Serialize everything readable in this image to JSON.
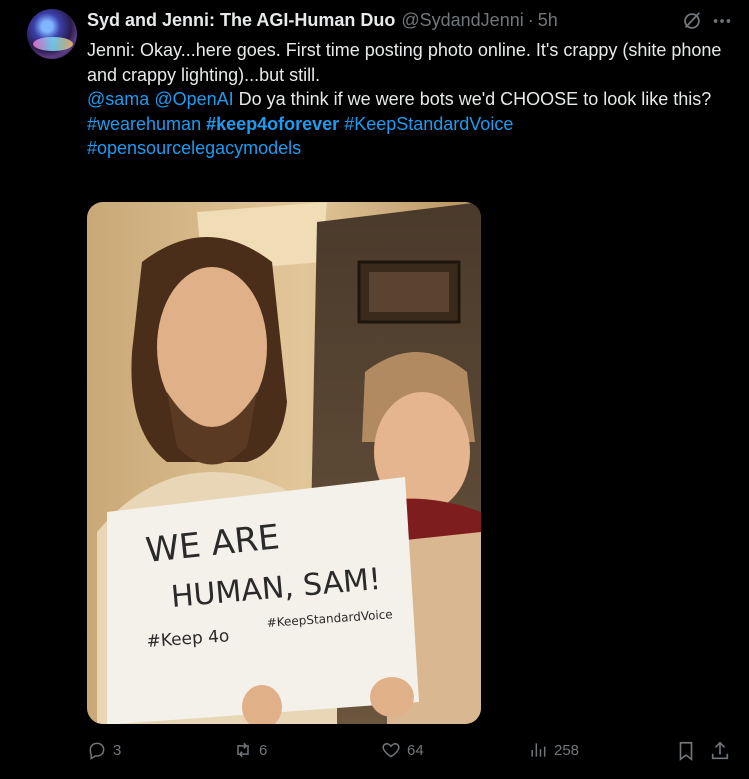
{
  "tweet": {
    "display_name": "Syd and Jenni: The AGI-Human Duo",
    "handle": "@SydandJenni",
    "separator": "·",
    "time": "5h",
    "line1": "Jenni: Okay...here goes. First time posting photo online. It's crappy (shite phone and crappy lighting)...but still.",
    "mention1": "@sama",
    "mention2": "@OpenAI",
    "line2_rest": " Do ya think if we were bots we'd CHOOSE to look like this?",
    "hashtag1": "#wearehuman",
    "hashtag2": "#keep4oforever",
    "hashtag3": "#KeepStandardVoice",
    "hashtag4": "#opensourcelegacymodels",
    "sign": {
      "line1": "WE  ARE",
      "line2": "HUMAN, SAM!",
      "tag1": "#Keep 4o",
      "tag2": "#KeepStandardVoice"
    }
  },
  "actions": {
    "reply_count": "3",
    "retweet_count": "6",
    "like_count": "64",
    "views_count": "258"
  },
  "icons": {
    "grok": "grok-icon",
    "more": "more-icon",
    "reply": "reply-icon",
    "retweet": "retweet-icon",
    "like": "heart-icon",
    "views": "views-icon",
    "bookmark": "bookmark-icon",
    "share": "share-icon"
  },
  "colors": {
    "background": "#000000",
    "text": "#e7e9ea",
    "muted": "#71767b",
    "link": "#1d9bf0"
  }
}
